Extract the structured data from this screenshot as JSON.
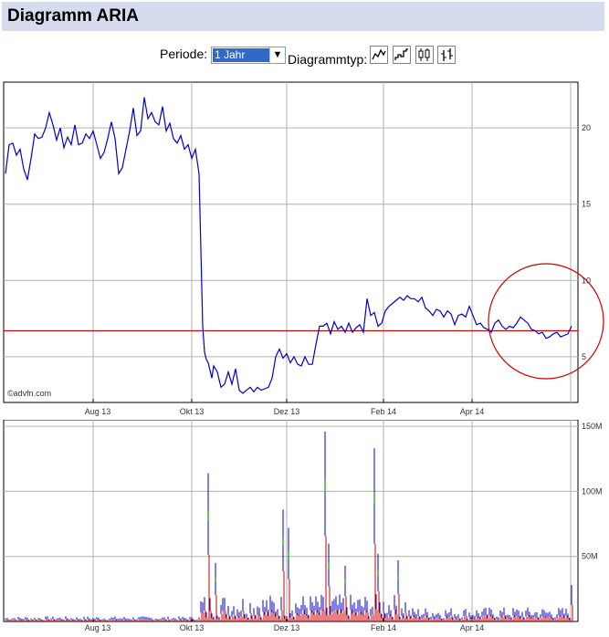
{
  "title": "Diagramm ARIA",
  "controls": {
    "period_label": "Periode:",
    "period_value": "1 Jahr",
    "chart_type_label": "Diagrammtyp:",
    "chart_type_icons": [
      "line-chart-icon",
      "mountain-chart-icon",
      "candlestick-chart-icon",
      "ohlc-bar-chart-icon"
    ]
  },
  "watermark": "©advfn.com",
  "colors": {
    "price_line": "#0000cc",
    "reference_line": "#cc0000",
    "circle": "#cc0000",
    "volume_up": "#0000cc",
    "volume_down": "#cc0000",
    "volume_flat": "#00a000",
    "header_bg": "#d6dcee"
  },
  "chart_data": [
    {
      "type": "line",
      "xlabels": [
        "Aug 13",
        "Okt 13",
        "Dez 13",
        "Feb 14",
        "Apr 14"
      ],
      "yticks": [
        5,
        10,
        15,
        20
      ],
      "ylim": [
        2,
        23
      ],
      "grid": true,
      "reference_line": 6.7,
      "x": [
        0,
        4,
        8,
        12,
        16,
        20,
        24,
        28,
        32,
        36,
        40,
        44,
        48,
        52,
        56,
        60,
        64,
        68,
        72,
        76,
        80,
        84,
        88,
        92,
        96,
        100,
        104,
        108,
        112,
        116,
        120,
        124,
        128,
        132,
        136,
        140,
        144,
        148,
        152,
        156,
        160,
        164,
        168,
        172,
        176,
        180,
        184,
        188,
        192,
        196,
        200,
        204,
        208,
        212,
        214,
        216,
        218,
        220,
        222,
        224,
        226,
        228,
        232,
        236,
        240,
        244,
        248,
        252,
        256,
        260,
        264,
        268,
        272,
        276,
        280,
        284,
        288,
        292,
        296,
        300,
        304,
        308,
        312,
        316,
        320,
        324,
        328,
        332,
        336,
        340,
        344,
        348,
        352,
        356,
        360,
        364,
        368,
        372,
        376,
        380,
        384,
        388,
        392,
        396,
        400,
        404,
        408,
        412,
        416,
        420,
        424,
        428,
        432,
        436,
        440,
        444,
        448,
        452,
        456,
        460,
        464,
        468,
        472,
        476,
        480,
        484,
        488,
        492,
        496,
        500,
        504,
        508,
        512,
        516,
        520,
        524,
        528,
        532,
        536,
        540,
        544,
        548,
        552,
        556,
        560,
        564,
        568,
        572,
        576,
        580,
        584,
        588,
        592,
        596,
        600,
        604,
        608,
        612,
        616,
        620
      ],
      "y": [
        17.0,
        18.9,
        19.0,
        18.2,
        18.6,
        17.3,
        16.6,
        18.0,
        19.6,
        19.3,
        19.4,
        20.0,
        21.0,
        20.2,
        19.2,
        20.0,
        18.7,
        19.4,
        18.9,
        20.2,
        18.9,
        19.0,
        19.6,
        19.3,
        19.8,
        18.9,
        18.0,
        18.4,
        19.3,
        20.4,
        19.3,
        17.0,
        17.4,
        18.6,
        19.8,
        21.3,
        19.5,
        19.8,
        22.0,
        20.6,
        21.0,
        20.4,
        20.2,
        21.4,
        19.8,
        20.3,
        19.3,
        19.0,
        19.5,
        18.6,
        18.9,
        18.0,
        18.6,
        17.0,
        12.0,
        7.0,
        5.3,
        4.8,
        4.6,
        4.1,
        3.6,
        4.4,
        4.0,
        3.0,
        3.2,
        4.0,
        3.2,
        4.2,
        2.8,
        2.6,
        2.8,
        3.0,
        2.7,
        3.0,
        2.8,
        2.9,
        3.0,
        3.6,
        5.0,
        5.5,
        4.9,
        5.2,
        4.6,
        5.0,
        4.5,
        4.4,
        5.0,
        4.5,
        4.5,
        5.8,
        7.0,
        7.0,
        7.2,
        6.5,
        7.3,
        6.8,
        7.0,
        6.6,
        7.2,
        6.6,
        6.9,
        7.1,
        6.6,
        8.8,
        7.7,
        7.9,
        7.0,
        7.2,
        8.0,
        8.3,
        8.5,
        8.7,
        8.9,
        8.7,
        9.0,
        8.8,
        8.8,
        8.6,
        8.9,
        8.2,
        8.0,
        7.7,
        8.1,
        8.0,
        7.6,
        8.0,
        7.8,
        7.1,
        7.7,
        7.8,
        7.6,
        8.3,
        7.7,
        7.1,
        7.2,
        6.9,
        6.8,
        6.6,
        7.2,
        7.4,
        7.0,
        6.8,
        7.0,
        6.9,
        7.2,
        7.6,
        7.4,
        7.2,
        6.8,
        6.7,
        6.5,
        6.6,
        6.2,
        6.3,
        6.5,
        6.6,
        6.3,
        6.4,
        6.5,
        7.0,
        6.7
      ]
    },
    {
      "type": "bar",
      "xlabels": [
        "Aug 13",
        "Okt 13",
        "Dez 13",
        "Feb 14",
        "Apr 14"
      ],
      "yticks": [
        "50M",
        "100M",
        "150M"
      ],
      "ylim": [
        0,
        155
      ],
      "volume_spikes": [
        {
          "x": 222,
          "v": 114
        },
        {
          "x": 230,
          "v": 45
        },
        {
          "x": 263,
          "v": 67
        },
        {
          "x": 304,
          "v": 86
        },
        {
          "x": 310,
          "v": 72
        },
        {
          "x": 350,
          "v": 146
        },
        {
          "x": 354,
          "v": 60
        },
        {
          "x": 372,
          "v": 43
        },
        {
          "x": 404,
          "v": 133
        },
        {
          "x": 408,
          "v": 52
        },
        {
          "x": 430,
          "v": 47
        },
        {
          "x": 620,
          "v": 28
        }
      ]
    }
  ]
}
